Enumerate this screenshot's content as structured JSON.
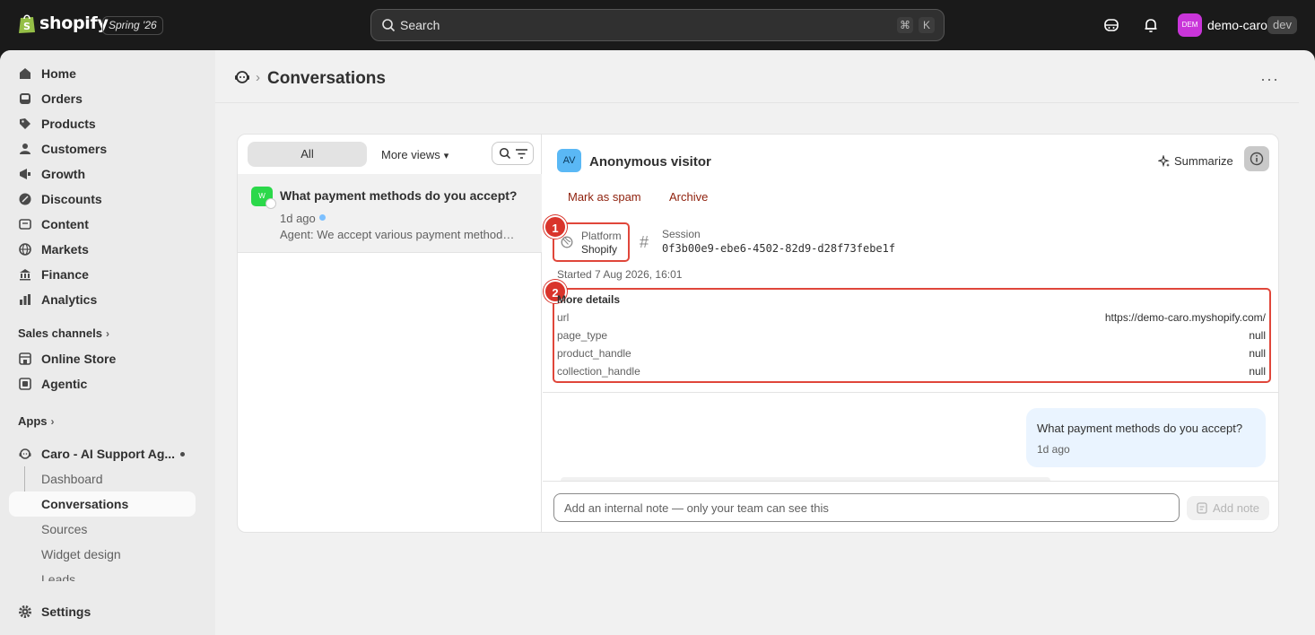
{
  "topbar": {
    "logo_text": "shopify",
    "edition": "Spring '26",
    "search_placeholder": "Search",
    "shortcut_key1": "⌘",
    "shortcut_key2": "K",
    "store_initials": "DEM",
    "store_name": "demo-caro",
    "env_badge": "dev"
  },
  "sidebar": {
    "items": [
      {
        "label": "Home",
        "icon": "home-icon"
      },
      {
        "label": "Orders",
        "icon": "inbox-icon"
      },
      {
        "label": "Products",
        "icon": "tag-icon"
      },
      {
        "label": "Customers",
        "icon": "person-icon"
      },
      {
        "label": "Growth",
        "icon": "megaphone-icon"
      },
      {
        "label": "Discounts",
        "icon": "discount-icon"
      },
      {
        "label": "Content",
        "icon": "content-icon"
      },
      {
        "label": "Markets",
        "icon": "globe-icon"
      },
      {
        "label": "Finance",
        "icon": "bank-icon"
      },
      {
        "label": "Analytics",
        "icon": "chart-icon"
      }
    ],
    "sales_channels_heading": "Sales channels",
    "channels": [
      {
        "label": "Online Store",
        "icon": "store-icon"
      },
      {
        "label": "Agentic",
        "icon": "agentic-icon"
      }
    ],
    "apps_heading": "Apps",
    "app": {
      "label": "Caro - AI Support Ag...",
      "icon": "app-headset-icon"
    },
    "app_subitems": [
      "Dashboard",
      "Conversations",
      "Sources",
      "Widget design",
      "Leads"
    ],
    "active_subitem": "Conversations",
    "settings": "Settings"
  },
  "page": {
    "title": "Conversations"
  },
  "list": {
    "tab_all": "All",
    "tab_more": "More views",
    "conversations": [
      {
        "avatar": "W",
        "title": "What payment methods do you accept?",
        "time": "1d ago",
        "preview": "Agent: We accept various payment methods including credit cards"
      }
    ]
  },
  "detail": {
    "visitor_initials": "AV",
    "visitor_name": "Anonymous visitor",
    "summarize": "Summarize",
    "mark_spam": "Mark as spam",
    "archive": "Archive",
    "platform_label": "Platform",
    "platform_value": "Shopify",
    "session_label": "Session",
    "session_value": "0f3b00e9-ebe6-4502-82d9-d28f73febe1f",
    "started": "Started 7 Aug 2026, 16:01",
    "more_details_title": "More details",
    "more_details": [
      {
        "key": "url",
        "value": "https://demo-caro.myshopify.com/"
      },
      {
        "key": "page_type",
        "value": "null"
      },
      {
        "key": "product_handle",
        "value": "null"
      },
      {
        "key": "collection_handle",
        "value": "null"
      }
    ],
    "markers": [
      "1",
      "2"
    ],
    "message": {
      "text": "What payment methods do you accept?",
      "time": "1d ago"
    },
    "note_placeholder": "Add an internal note — only your team can see this",
    "add_note": "Add note"
  },
  "colors": {
    "topbar_bg": "#1a1a1a",
    "frame_bg": "#f1f1f1",
    "sidebar_bg": "#ebebeb",
    "link_red": "#8e1f0b",
    "highlight_red": "#e0463a",
    "visitor_badge": "#5ab8f5",
    "store_avatar": "#c935d9",
    "message_bubble": "#eaf4ff"
  }
}
